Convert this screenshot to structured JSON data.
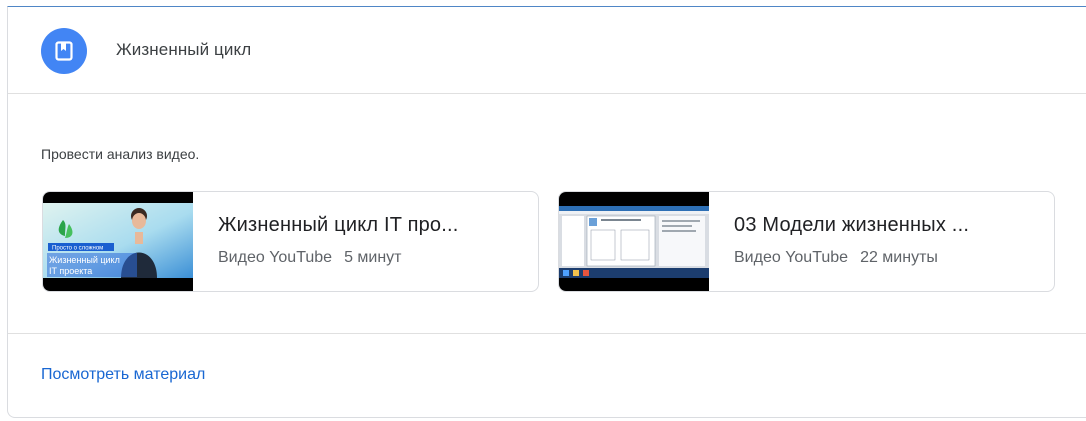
{
  "header": {
    "icon": "bookmark-icon",
    "title": "Жизненный цикл"
  },
  "description": "Провести анализ видео.",
  "videos": [
    {
      "title": "Жизненный цикл IT про...",
      "source": "Видео YouTube",
      "duration": "5 минут",
      "thumbnail": {
        "badge": "Просто о сложном",
        "caption_line1": "Жизненный цикл",
        "caption_line2": "IT проекта"
      }
    },
    {
      "title": "03 Модели жизненных ...",
      "source": "Видео YouTube",
      "duration": "22 минуты"
    }
  ],
  "footer": {
    "link_label": "Посмотреть материал"
  },
  "colors": {
    "accent": "#4285f4",
    "link": "#1967d2",
    "top_border": "#4f86c6"
  }
}
